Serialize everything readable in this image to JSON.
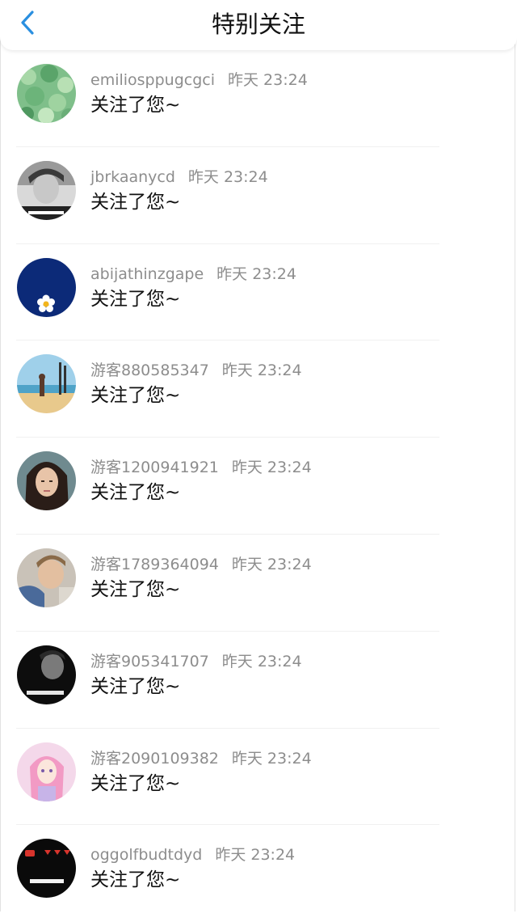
{
  "header": {
    "title": "特别关注",
    "back_icon": "chevron-left-icon",
    "accent_color": "#2a8fe0"
  },
  "notifications": [
    {
      "user": "emiliosppugcgci",
      "time": "昨天 23:24",
      "action": "关注了您~",
      "avatar": "clover-leaves"
    },
    {
      "user": "jbrkaanycd",
      "time": "昨天 23:24",
      "action": "关注了您~",
      "avatar": "grayscale-portrait"
    },
    {
      "user": "abijathinzgape",
      "time": "昨天 23:24",
      "action": "关注了您~",
      "avatar": "white-flower-on-navy"
    },
    {
      "user": "游客880585347",
      "time": "昨天 23:24",
      "action": "关注了您~",
      "avatar": "beach-scene"
    },
    {
      "user": "游客1200941921",
      "time": "昨天 23:24",
      "action": "关注了您~",
      "avatar": "woman-portrait"
    },
    {
      "user": "游客1789364094",
      "time": "昨天 23:24",
      "action": "关注了您~",
      "avatar": "man-in-denim"
    },
    {
      "user": "游客905341707",
      "time": "昨天 23:24",
      "action": "关注了您~",
      "avatar": "dark-silhouette"
    },
    {
      "user": "游客2090109382",
      "time": "昨天 23:24",
      "action": "关注了您~",
      "avatar": "pink-anime-girl"
    },
    {
      "user": "oggolfbudtdyd",
      "time": "昨天 23:24",
      "action": "关注了您~",
      "avatar": "black-with-red-hearts"
    }
  ]
}
